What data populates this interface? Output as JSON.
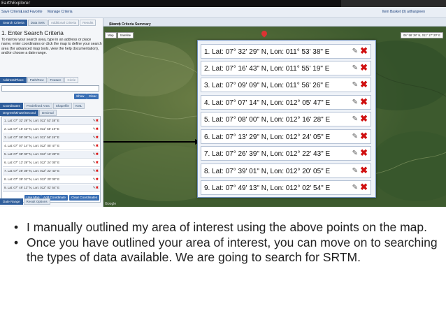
{
  "app": {
    "title": "EarthExplorer"
  },
  "menu": {
    "items": [
      "Save Criteria",
      "Load Favorite",
      "Manage Criteria"
    ],
    "right": "Item Basket (0)   arthargreen"
  },
  "left_panel": {
    "tabs": [
      "Search Criteria",
      "Data Sets",
      "Additional Criteria",
      "Results"
    ],
    "title": "1. Enter Search Criteria",
    "instructions": "To narrow your search area, type in an address or place name, enter coordinates or click the map to define your search area (for advanced map tools, view the help documentation), and/or choose a date range.",
    "address_tabs": [
      "Address/Place",
      "Path/Row",
      "Feature",
      "Circle"
    ],
    "show_button": "Show",
    "clear_button": "Clear",
    "coord_tabs": [
      "Coordinates",
      "Predefined Area",
      "Shapefile",
      "KML"
    ],
    "format_tabs": [
      "Degree/Minute/Second",
      "Decimal"
    ],
    "coordinates": [
      "1.  Lat: 07° 32' 29\" N, Lon: 011° 53' 38\" E",
      "2.  Lat: 07° 16' 43\" N, Lon: 011° 55' 19\" E",
      "3.  Lat: 07° 09' 09\" N, Lon: 011° 56' 26\" E",
      "4.  Lat: 07° 07' 14\" N, Lon: 012° 05' 47\" E",
      "5.  Lat: 07° 08' 00\" N, Lon: 012° 16' 28\" E",
      "6.  Lat: 07° 13' 29\" N, Lon: 012° 24' 05\" E",
      "7.  Lat: 07° 26' 39\" N, Lon: 012° 22' 43\" E",
      "8.  Lat: 07° 39' 01\" N, Lon: 012° 20' 05\" E",
      "9.  Lat: 07° 49' 13\" N, Lon: 012° 02' 54\" E"
    ],
    "use_map_button": "Use Map",
    "add_coordinate_button": "Add Coordinate",
    "clear_coordinates_button": "Clear Coordinates",
    "bottom_tabs": [
      "Date Range",
      "Result Options"
    ]
  },
  "summary": {
    "header": "Search Criteria Summary",
    "show": "(Show)"
  },
  "map": {
    "controls": [
      "Map",
      "Satellite"
    ],
    "readout": "06° 58' 28\" N, 011° 27' 20\" E",
    "credit": "Google"
  },
  "overlay": {
    "rows": [
      "1.  Lat: 07° 32' 29\" N, Lon: 011° 53' 38\" E",
      "2.  Lat: 07° 16' 43\" N, Lon: 011° 55' 19\" E",
      "3.  Lat: 07° 09' 09\" N, Lon: 011° 56' 26\" E",
      "4.  Lat: 07° 07' 14\" N, Lon: 012° 05' 47\" E",
      "5.  Lat: 07° 08' 00\" N, Lon: 012° 16' 28\" E",
      "6.  Lat: 07° 13' 29\" N, Lon: 012° 24' 05\" E",
      "7.  Lat: 07° 26' 39\" N, Lon: 012° 22' 43\" E",
      "8.  Lat: 07° 39' 01\" N, Lon: 012° 20' 05\" E",
      "9.  Lat: 07° 49' 13\" N, Lon: 012° 02' 54\" E"
    ]
  },
  "bullets": [
    "I manually outlined my area of interest using the above points on the map.",
    "Once you have outlined your area of interest, you can move on to searching the types of data available. We are going to search for SRTM."
  ]
}
